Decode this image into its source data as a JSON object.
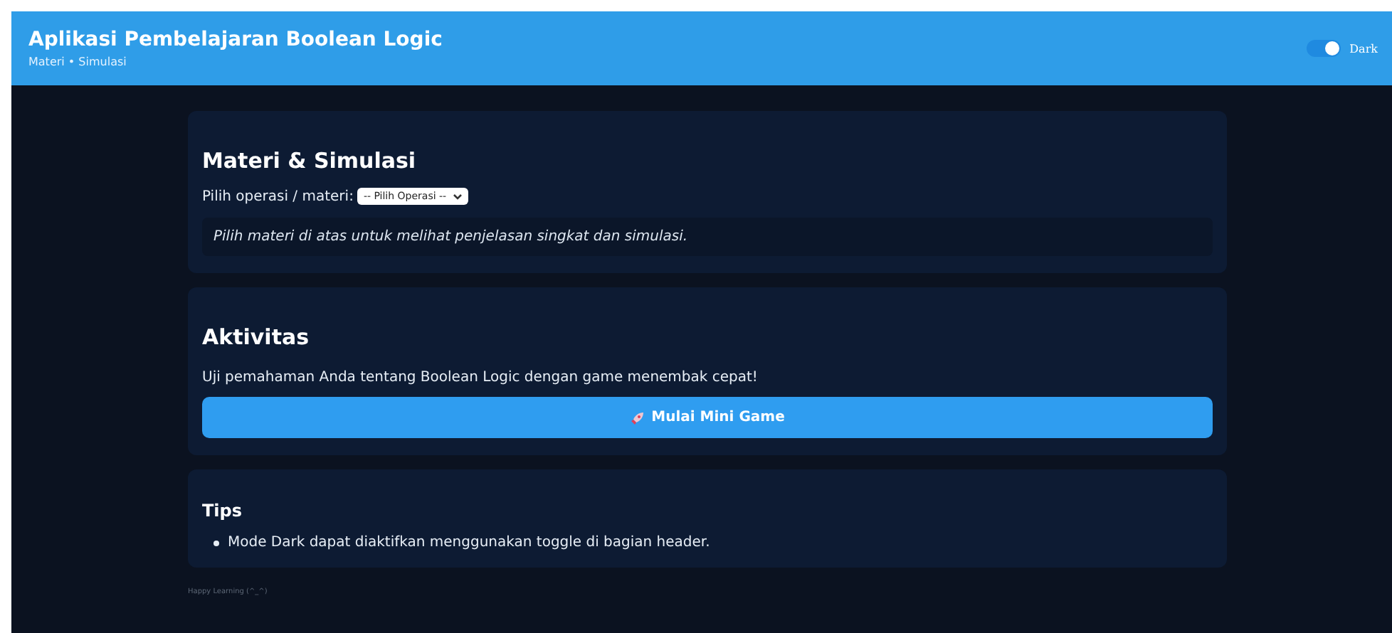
{
  "header": {
    "title": "Aplikasi Pembelajaran Boolean Logic",
    "subtitle": "Materi • Simulasi",
    "theme_toggle": {
      "label": "Dark",
      "on": true
    }
  },
  "materi": {
    "title": "Materi & Simulasi",
    "select_label": "Pilih operasi / materi:",
    "select_value": "-- Pilih Operasi --",
    "hint": "Pilih materi di atas untuk melihat penjelasan singkat dan simulasi."
  },
  "aktivitas": {
    "title": "Aktivitas",
    "description": "Uji pemahaman Anda tentang Boolean Logic dengan game menembak cepat!",
    "button": "Mulai Mini Game"
  },
  "tips": {
    "title": "Tips",
    "items": [
      "Mode Dark dapat diaktifkan menggunakan toggle di bagian header."
    ]
  },
  "footer": "Happy Learning (^_^)"
}
